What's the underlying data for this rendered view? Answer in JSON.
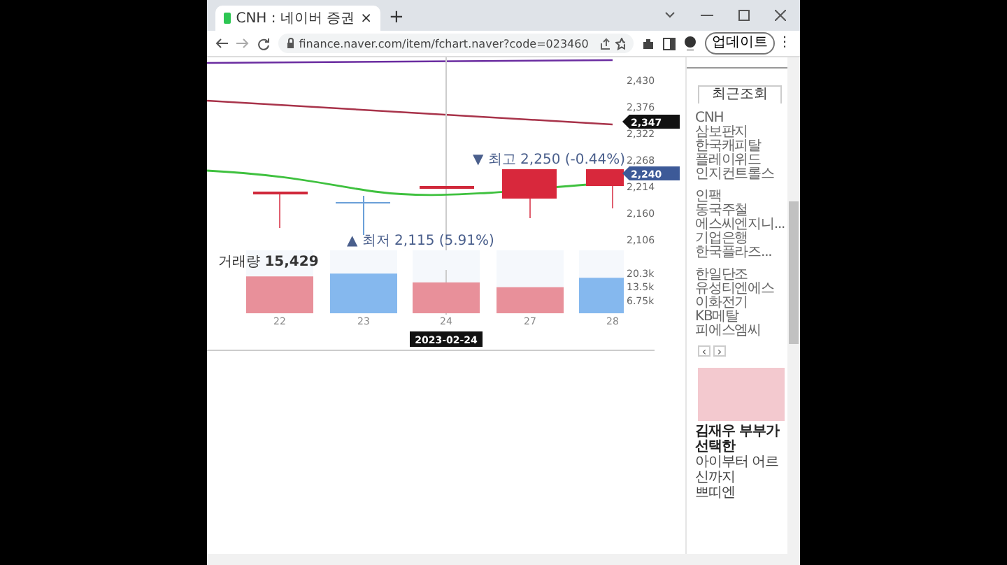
{
  "browser": {
    "tab_title": "CNH : 네이버 증권",
    "tab_close": "×",
    "new_tab": "+",
    "url": "finance.naver.com/item/fchart.naver?code=023460",
    "update_button": "업데이트",
    "menu": "⋮"
  },
  "price_chart": {
    "y_labels": [
      "2,430",
      "2,376",
      "2,322",
      "2,268",
      "2,214",
      "2,160",
      "2,106"
    ],
    "current_tags": [
      {
        "label": "2,347",
        "color": "#111111"
      },
      {
        "label": "2,240",
        "color": "#3d5a98"
      }
    ],
    "high_note": "▼ 최고 2,250 (-0.44%)",
    "low_note": "▲ 최저 2,115 (5.91%)"
  },
  "volume": {
    "label": "거래량",
    "value": "15,429",
    "crosshair_date": "2023-02-24",
    "chart_data": {
      "type": "bar",
      "categories": [
        "22",
        "23",
        "24",
        "27",
        "28"
      ],
      "stacked": true,
      "ylim": [
        0,
        31.4
      ],
      "series": [
        {
          "color": "#e8909a",
          "values": [
            18.4,
            null,
            15.4,
            13.0,
            null
          ]
        },
        {
          "color": "#85b8ee",
          "values": [
            null,
            19.8,
            null,
            null,
            17.7
          ]
        }
      ],
      "yticks": [
        {
          "value": 6.75,
          "label": "6.75k"
        },
        {
          "value": 13.5,
          "label": "13.5k"
        },
        {
          "value": 20.3,
          "label": "20.3k"
        }
      ]
    }
  },
  "sidebar": {
    "tab": "최근조회",
    "groups": [
      [
        "CNH",
        "삼보판지",
        "한국캐피탈",
        "플레이위드",
        "인지컨트롤스"
      ],
      [
        "인팩",
        "동국주철",
        "에스씨엔지니...",
        "기업은행",
        "한국플라즈..."
      ],
      [
        "한일단조",
        "유성티엔에스",
        "이화전기",
        "KB메탈",
        "피에스엠씨"
      ]
    ],
    "pager": [
      "‹",
      "›"
    ]
  },
  "ad": {
    "lines": [
      "김재우 부부가 선택한",
      "아이부터 어르신까지",
      "쁘띠엔"
    ]
  }
}
